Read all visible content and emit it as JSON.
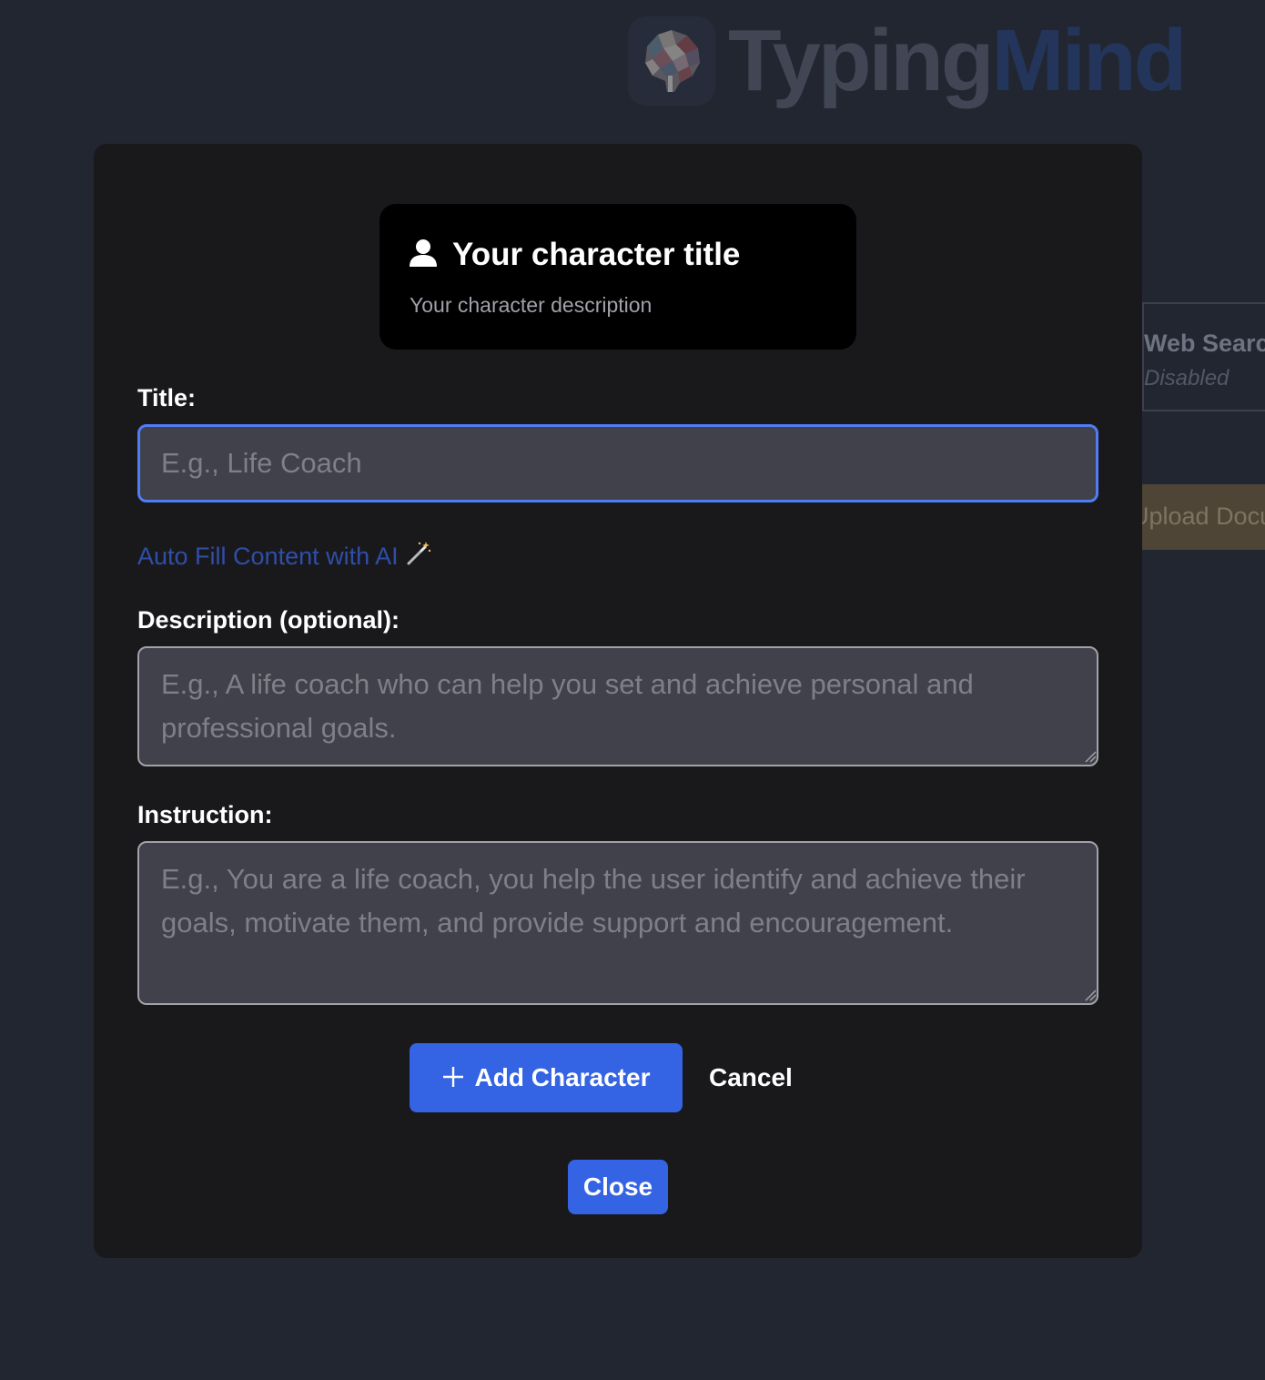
{
  "background": {
    "logo": {
      "part1": "Typing",
      "part2": "Mind"
    },
    "feature": {
      "name": "Web Search",
      "state": "Disabled"
    },
    "upload_label": "Upload Documents"
  },
  "modal": {
    "preview": {
      "icon": "user-icon",
      "title": "Your character title",
      "description": "Your character description"
    },
    "title_label": "Title:",
    "title_placeholder": "E.g., Life Coach",
    "title_value": "",
    "autofill_label": "Auto Fill Content with AI",
    "autofill_icon": "magic-wand-icon",
    "description_label": "Description (optional):",
    "description_placeholder": "E.g., A life coach who can help you set and achieve personal and professional goals.",
    "description_value": "",
    "instruction_label": "Instruction:",
    "instruction_placeholder": "E.g., You are a life coach, you help the user identify and achieve their goals, motivate them, and provide support and encouragement.",
    "instruction_value": "",
    "add_button_label": "Add Character",
    "add_button_icon": "plus-icon",
    "cancel_label": "Cancel",
    "close_label": "Close"
  },
  "colors": {
    "page_background": "#212631",
    "modal_background": "#19191c",
    "accent": "#3464e3",
    "focus_border": "#4f7df2",
    "link": "#2f4ea8"
  }
}
